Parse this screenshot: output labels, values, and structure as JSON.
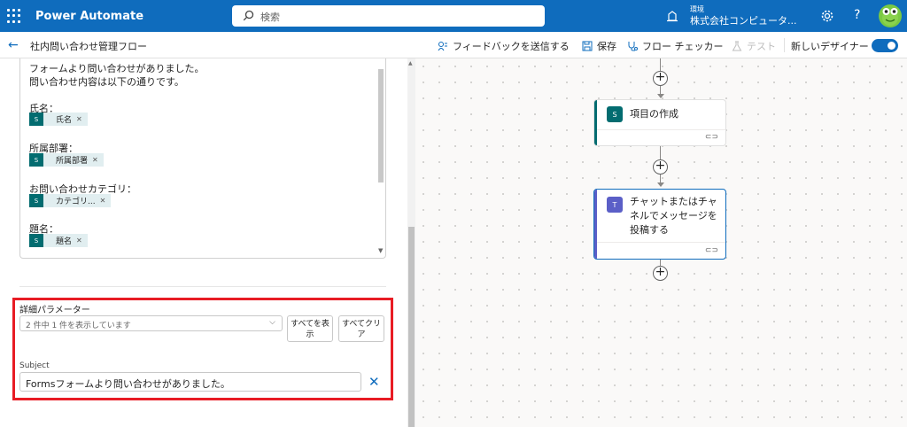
{
  "header": {
    "app_title": "Power Automate",
    "search_placeholder": "検索",
    "environment_label": "環境",
    "environment_name": "株式会社コンピュータ...",
    "help": "?"
  },
  "commandbar": {
    "back": "←",
    "flow_name": "社内問い合わせ管理フロー",
    "feedback": "フィードバックを送信する",
    "save": "保存",
    "flow_checker": "フロー チェッカー",
    "test": "テスト",
    "new_designer": "新しいデザイナー"
  },
  "message": {
    "line1": "フォームより問い合わせがありました。",
    "line2": "問い合わせ内容は以下の通りです。",
    "fields": [
      {
        "label": "氏名：",
        "token": "氏名"
      },
      {
        "label": "所属部署：",
        "token": "所属部署"
      },
      {
        "label": "お問い合わせカテゴリ：",
        "token": "カテゴリ..."
      },
      {
        "label": "題名：",
        "token": "題名"
      }
    ]
  },
  "advanced": {
    "label": "詳細パラメーター",
    "select_value": "2 件中 1 件を表示しています",
    "show_all": "すべてを表示",
    "clear_all": "すべてクリア",
    "subject_label": "Subject",
    "subject_value": "Formsフォームより問い合わせがありました。"
  },
  "canvas": {
    "card1_title": "項目の作成",
    "card2_title": "チャットまたはチャネルでメッセージを投稿する"
  },
  "colors": {
    "brand": "#0f6cbd",
    "sharepoint": "#036c70",
    "teams": "#5b5fc7",
    "highlight": "#e81c24"
  }
}
